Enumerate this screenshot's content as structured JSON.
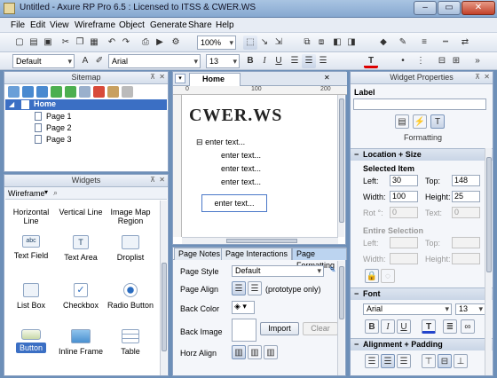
{
  "window": {
    "title": "Untitled - Axure RP Pro 6.5 : Licensed to ITSS & CWER.WS",
    "min": "–",
    "max": "▭",
    "close": "✕"
  },
  "menu": [
    "File",
    "Edit",
    "View",
    "Wireframe",
    "Object",
    "Generate",
    "Share",
    "Help"
  ],
  "toolbar": {
    "zoom": "100%",
    "style": "Default",
    "font": "Arial",
    "size": "13",
    "bold": "B",
    "italic": "I",
    "underline": "U",
    "text_color": "T"
  },
  "sitemap": {
    "title": "Sitemap",
    "root": "Home",
    "pages": [
      "Page 1",
      "Page 2",
      "Page 3"
    ]
  },
  "widgets": {
    "title": "Widgets",
    "library": "Wireframe",
    "items": [
      {
        "label": "Horizontal Line"
      },
      {
        "label": "Vertical Line"
      },
      {
        "label": "Image Map Region"
      },
      {
        "label": "Text Field"
      },
      {
        "label": "Text Area"
      },
      {
        "label": "Droplist"
      },
      {
        "label": "List Box"
      },
      {
        "label": "Checkbox"
      },
      {
        "label": "Radio Button"
      },
      {
        "label": "Button"
      },
      {
        "label": "Inline Frame"
      },
      {
        "label": "Table"
      }
    ]
  },
  "canvas": {
    "tab": "Home",
    "ruler": [
      "0",
      "100",
      "200"
    ],
    "watermark": "CWER.WS",
    "texts": [
      "enter text...",
      "enter text...",
      "enter text...",
      "enter text..."
    ],
    "selected_text": "enter text..."
  },
  "bottom_tabs": [
    "Page Notes",
    "Page Interactions",
    "Page Formatting"
  ],
  "page_formatting": {
    "page_style_label": "Page Style",
    "page_style_value": "Default",
    "page_align_label": "Page Align",
    "page_align_note": "(prototype only)",
    "back_color_label": "Back Color",
    "back_image_label": "Back Image",
    "import": "Import",
    "clear": "Clear",
    "horz_align_label": "Horz Align"
  },
  "widget_props": {
    "title": "Widget Properties",
    "label_title": "Label",
    "tab_caption": "Formatting",
    "location_size": "Location + Size",
    "selected_item": "Selected Item",
    "left_label": "Left:",
    "left": "30",
    "top_label": "Top:",
    "top": "148",
    "width_label": "Width:",
    "width": "100",
    "height_label": "Height:",
    "height": "25",
    "rot_label": "Rot °:",
    "rot": "0",
    "text_label": "Text:",
    "text": "0",
    "entire_selection": "Entire Selection",
    "es_left": "Left:",
    "es_top": "Top:",
    "es_width": "Width:",
    "es_height": "Height:",
    "font_section": "Font",
    "font": "Arial",
    "font_size": "13",
    "align_section": "Alignment + Padding"
  }
}
